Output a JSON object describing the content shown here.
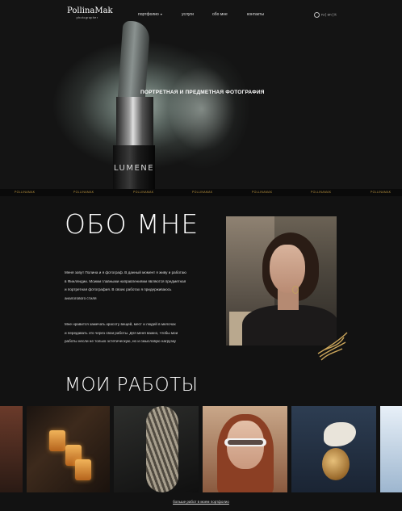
{
  "header": {
    "logo_name": "PollinaMak",
    "logo_sub": "photographer",
    "nav": [
      {
        "label": "портфолио"
      },
      {
        "label": "услуги"
      },
      {
        "label": "обо мне"
      },
      {
        "label": "контакты"
      }
    ],
    "lang": "ru | en | it"
  },
  "hero": {
    "title": "ПОРТРЕТНАЯ И ПРЕДМЕТНАЯ ФОТОГРАФИЯ",
    "product_text": "LUMENE"
  },
  "strip": {
    "items": [
      "POLLINAMAK",
      "POLLINAMAK",
      "POLLINAMAK",
      "POLLINAMAK",
      "POLLINAMAK",
      "POLLINAMAK",
      "POLLINAMAK"
    ]
  },
  "about": {
    "title": "ОБО МНЕ",
    "paragraph1": [
      "Меня зовут Полина и я фотограф. В данный момент я живу и работаю",
      "в Финляндии. Моими главными направлениями являются предметная",
      "и портретная фотография. В своих работах я придерживаюсь",
      "аналогового стиля"
    ],
    "paragraph2": [
      "Мне нравится замечать красоту вещей, мест и людей в мелочах",
      "и передавать это через свои работы. Для меня важно, чтобы мои",
      "работы несли не только эстетическую, но и смысловую нагрузку"
    ]
  },
  "works": {
    "title": "МОИ РАБОТЫ",
    "more_link": "больше работ в моем портфолио"
  }
}
